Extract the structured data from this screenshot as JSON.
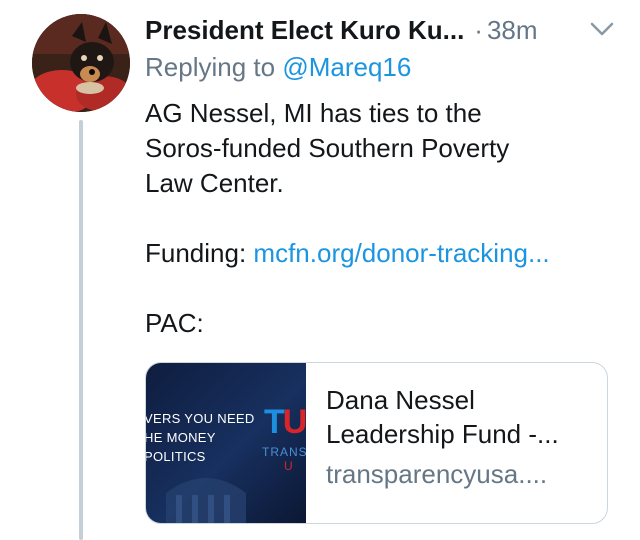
{
  "tweet": {
    "display_name": "President Elect Kuro Ku...",
    "separator": "·",
    "time": "38m",
    "reply_prefix": "Replying to",
    "reply_handle": "@Mareq16",
    "text_lines": [
      "AG Nessel, MI has ties to the",
      "Soros-funded Southern Poverty",
      "Law Center."
    ],
    "funding_label": "Funding:",
    "funding_link": "mcfn.org/donor-tracking...",
    "pac_label": "PAC:"
  },
  "card": {
    "title": "Dana Nessel Leadership Fund -...",
    "domain": "transparencyusa....",
    "thumb_tagline": [
      "VERS YOU NEED",
      "HE MONEY",
      "POLITICS"
    ],
    "thumb_logo_blue": "T",
    "thumb_logo_red": "U",
    "thumb_logo_text": "TRANS",
    "thumb_logo_text_red": "U"
  },
  "icons": {
    "avatar": "avatar-image",
    "menu": "chevron-down-icon"
  },
  "colors": {
    "link": "#1b95e0",
    "secondary": "#657786",
    "thread_line": "#c4cfd6"
  }
}
